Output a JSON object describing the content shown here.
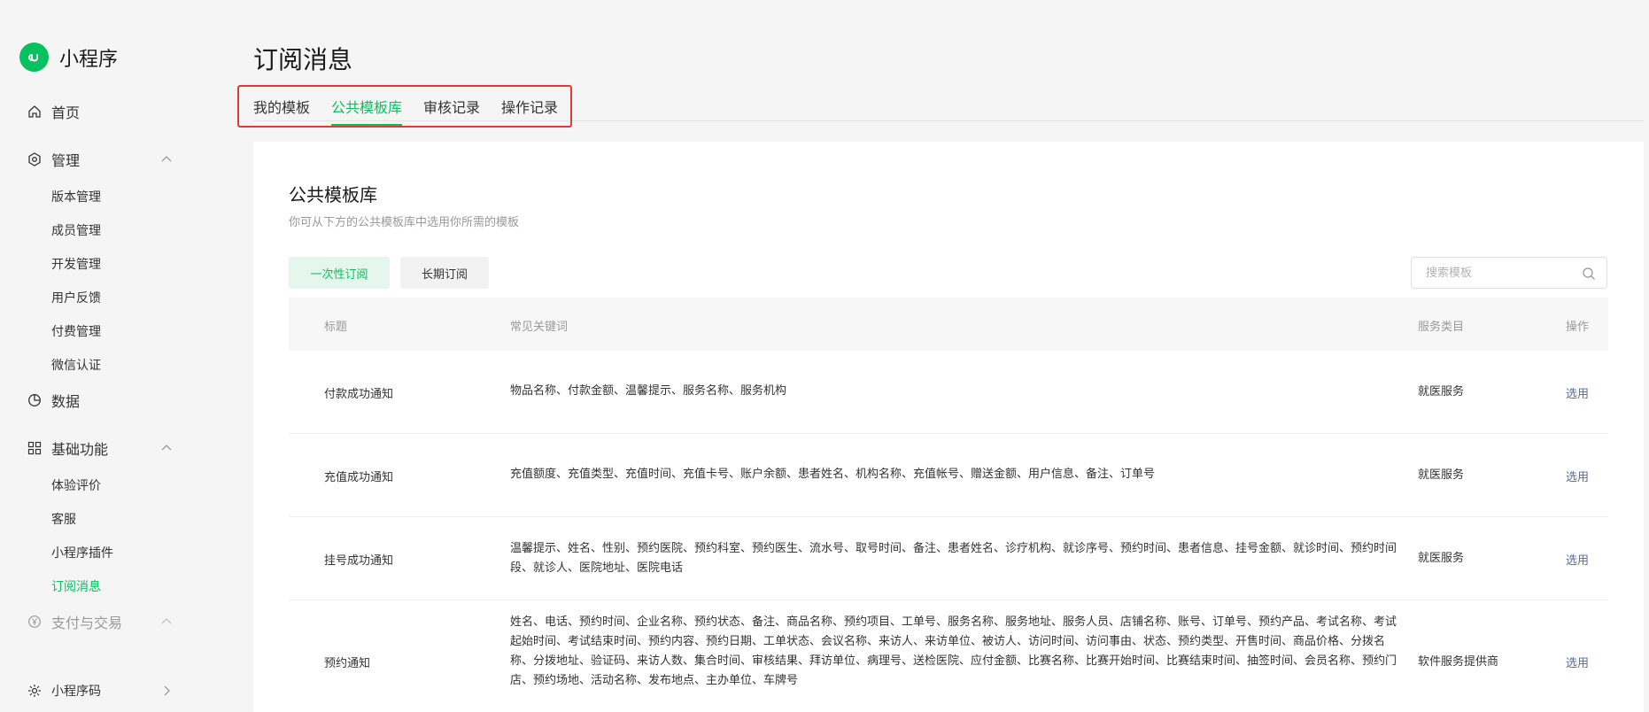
{
  "brand": {
    "name": "小程序"
  },
  "sidebar": {
    "home": "首页",
    "manage": {
      "label": "管理",
      "items": [
        "版本管理",
        "成员管理",
        "开发管理",
        "用户反馈",
        "付费管理",
        "微信认证"
      ]
    },
    "data": "数据",
    "basic": {
      "label": "基础功能",
      "items": [
        "体验评价",
        "客服",
        "小程序插件",
        "订阅消息"
      ]
    },
    "payment": "支付与交易",
    "qrcode": "小程序码"
  },
  "page": {
    "title": "订阅消息"
  },
  "tabs": [
    "我的模板",
    "公共模板库",
    "审核记录",
    "操作记录"
  ],
  "card": {
    "title": "公共模板库",
    "desc": "你可从下方的公共模板库中选用你所需的模板",
    "seg_once": "一次性订阅",
    "seg_long": "长期订阅",
    "search_placeholder": "搜索模板"
  },
  "table": {
    "headers": [
      "标题",
      "常见关键词",
      "服务类目",
      "操作"
    ],
    "rows": [
      {
        "title": "付款成功通知",
        "keywords": "物品名称、付款金额、温馨提示、服务名称、服务机构",
        "category": "就医服务",
        "action": "选用"
      },
      {
        "title": "充值成功通知",
        "keywords": "充值额度、充值类型、充值时间、充值卡号、账户余额、患者姓名、机构名称、充值帐号、赠送金额、用户信息、备注、订单号",
        "category": "就医服务",
        "action": "选用"
      },
      {
        "title": "挂号成功通知",
        "keywords": "温馨提示、姓名、性别、预约医院、预约科室、预约医生、流水号、取号时间、备注、患者姓名、诊疗机构、就诊序号、预约时间、患者信息、挂号金额、就诊时间、预约时间段、就诊人、医院地址、医院电话",
        "category": "就医服务",
        "action": "选用"
      },
      {
        "title": "预约通知",
        "keywords": "姓名、电话、预约时间、企业名称、预约状态、备注、商品名称、预约项目、工单号、服务名称、服务地址、服务人员、店铺名称、账号、订单号、预约产品、考试名称、考试起始时间、考试结束时间、预约内容、预约日期、工单状态、会议名称、来访人、来访单位、被访人、访问时间、访问事由、状态、预约类型、开售时间、商品价格、分拨名称、分拨地址、验证码、来访人数、集合时间、审核结果、拜访单位、病理号、送检医院、应付金额、比赛名称、比赛开始时间、比赛结束时间、抽签时间、会员名称、预约门店、预约场地、活动名称、发布地点、主办单位、车牌号",
        "category": "软件服务提供商",
        "action": "选用"
      }
    ]
  },
  "colors": {
    "accent": "#07c160",
    "link": "#576b95",
    "highlight": "#e53935"
  }
}
